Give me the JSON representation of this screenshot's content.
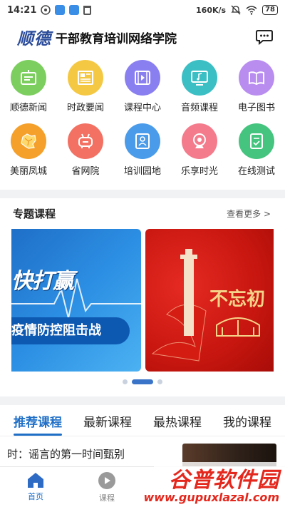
{
  "status_bar": {
    "time": "14:21",
    "speed": "160K/s",
    "battery": "78"
  },
  "header": {
    "logo": "顺德",
    "title": "干部教育培训网络学院",
    "message_icon": "chat-bubble-icon"
  },
  "grid": [
    {
      "label": "顺德新闻",
      "icon": "bulletin-icon",
      "color": "#7ccf5f"
    },
    {
      "label": "时政要闻",
      "icon": "newspaper-icon",
      "color": "#f5c843"
    },
    {
      "label": "课程中心",
      "icon": "video-icon",
      "color": "#8a7ff0"
    },
    {
      "label": "音频课程",
      "icon": "music-monitor-icon",
      "color": "#3bbfc4"
    },
    {
      "label": "电子图书",
      "icon": "book-icon",
      "color": "#b98df0"
    },
    {
      "label": "美丽凤城",
      "icon": "map-icon",
      "color": "#f4a02b"
    },
    {
      "label": "省网院",
      "icon": "robot-icon",
      "color": "#f27163"
    },
    {
      "label": "培训园地",
      "icon": "id-card-icon",
      "color": "#4a9be9"
    },
    {
      "label": "乐享时光",
      "icon": "camera-icon",
      "color": "#f47b8b"
    },
    {
      "label": "在线测试",
      "icon": "checklist-icon",
      "color": "#45c47f"
    }
  ],
  "section": {
    "title": "专题课程",
    "see_more": "查看更多 >"
  },
  "banners": {
    "blue_big": "快打赢",
    "blue_pill": "疫情防控阻击战",
    "red_text": "不忘初"
  },
  "tabs": [
    {
      "label": "推荐课程",
      "active": true
    },
    {
      "label": "最新课程",
      "active": false
    },
    {
      "label": "最热课程",
      "active": false
    },
    {
      "label": "我的课程",
      "active": false
    }
  ],
  "course": {
    "title": "时：谣言的第一时间甄别"
  },
  "bottom_nav": [
    {
      "label": "首页",
      "icon": "home-icon",
      "active": true
    },
    {
      "label": "课程",
      "icon": "play-icon",
      "active": false
    }
  ],
  "watermark": {
    "title": "谷普软件园",
    "url": "www.gupuxlazal.com"
  },
  "colors": {
    "accent": "#1f6fc7",
    "divider": "#f1f2f4"
  }
}
